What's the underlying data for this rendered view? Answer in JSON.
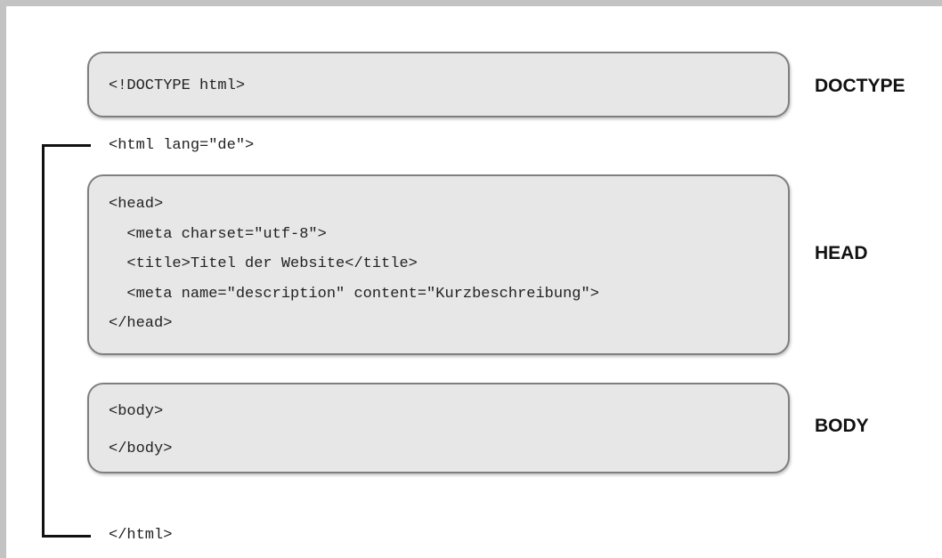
{
  "doctype": {
    "code": "<!DOCTYPE html>",
    "label": "DOCTYPE"
  },
  "html_open": "<html lang=\"de\">",
  "head": {
    "lines": [
      "<head>",
      "  <meta charset=\"utf-8\">",
      "  <title>Titel der Website</title>",
      "  <meta name=\"description\" content=\"Kurzbeschreibung\">",
      "</head>"
    ],
    "label": "HEAD"
  },
  "body": {
    "lines": [
      "<body>",
      "</body>"
    ],
    "label": "BODY"
  },
  "html_close": "</html>"
}
